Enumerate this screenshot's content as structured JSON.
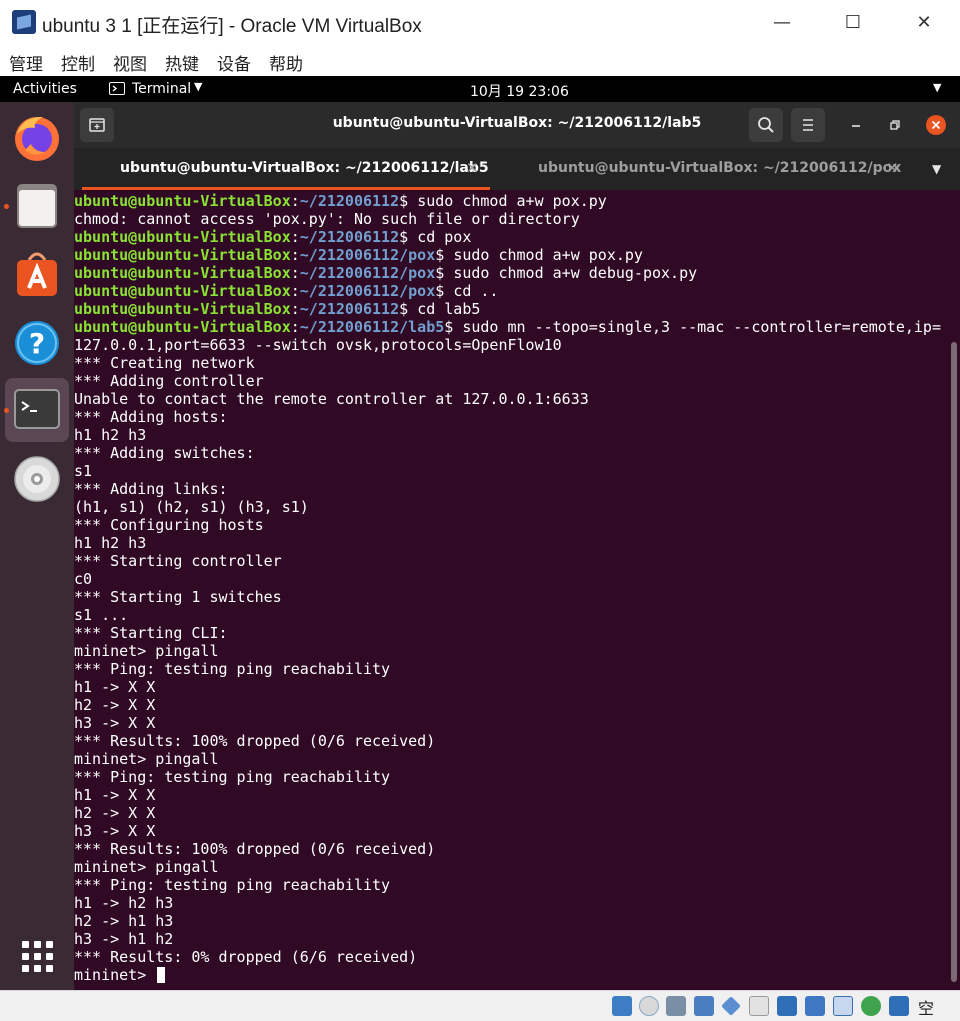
{
  "window": {
    "title": "ubuntu 3 1 [正在运行] - Oracle VM VirtualBox",
    "menu": [
      "管理",
      "控制",
      "视图",
      "热键",
      "设备",
      "帮助"
    ],
    "minimize": "—",
    "maximize": "☐",
    "close": "✕"
  },
  "topbar": {
    "activities": "Activities",
    "app_name": "Terminal",
    "datetime": "10月 19 23:06"
  },
  "terminal": {
    "header_title": "ubuntu@ubuntu-VirtualBox: ~/212006112/lab5",
    "tabs": [
      {
        "label": "ubuntu@ubuntu-VirtualBox: ~/212006112/lab5",
        "active": true
      },
      {
        "label": "ubuntu@ubuntu-VirtualBox: ~/212006112/pox",
        "active": false
      }
    ],
    "user_host": "ubuntu@ubuntu-VirtualBox",
    "lines": [
      {
        "path": "~/212006112",
        "cmd": "sudo chmod a+w pox.py"
      },
      {
        "text": "chmod: cannot access 'pox.py': No such file or directory"
      },
      {
        "path": "~/212006112",
        "cmd": "cd pox"
      },
      {
        "path": "~/212006112/pox",
        "cmd": "sudo chmod a+w pox.py"
      },
      {
        "path": "~/212006112/pox",
        "cmd": "sudo chmod a+w debug-pox.py"
      },
      {
        "path": "~/212006112/pox",
        "cmd": "cd .."
      },
      {
        "path": "~/212006112",
        "cmd": "cd lab5"
      },
      {
        "path": "~/212006112/lab5",
        "cmd": "sudo mn --topo=single,3 --mac --controller=remote,ip="
      },
      {
        "text": "127.0.0.1,port=6633 --switch ovsk,protocols=OpenFlow10"
      },
      {
        "text": "*** Creating network"
      },
      {
        "text": "*** Adding controller"
      },
      {
        "text": "Unable to contact the remote controller at 127.0.0.1:6633"
      },
      {
        "text": "*** Adding hosts:"
      },
      {
        "text": "h1 h2 h3"
      },
      {
        "text": "*** Adding switches:"
      },
      {
        "text": "s1"
      },
      {
        "text": "*** Adding links:"
      },
      {
        "text": "(h1, s1) (h2, s1) (h3, s1)"
      },
      {
        "text": "*** Configuring hosts"
      },
      {
        "text": "h1 h2 h3"
      },
      {
        "text": "*** Starting controller"
      },
      {
        "text": "c0"
      },
      {
        "text": "*** Starting 1 switches"
      },
      {
        "text": "s1 ..."
      },
      {
        "text": "*** Starting CLI:"
      },
      {
        "text": "mininet> pingall"
      },
      {
        "text": "*** Ping: testing ping reachability"
      },
      {
        "text": "h1 -> X X"
      },
      {
        "text": "h2 -> X X"
      },
      {
        "text": "h3 -> X X"
      },
      {
        "text": "*** Results: 100% dropped (0/6 received)"
      },
      {
        "text": "mininet> pingall"
      },
      {
        "text": "*** Ping: testing ping reachability"
      },
      {
        "text": "h1 -> X X"
      },
      {
        "text": "h2 -> X X"
      },
      {
        "text": "h3 -> X X"
      },
      {
        "text": "*** Results: 100% dropped (0/6 received)"
      },
      {
        "text": "mininet> pingall"
      },
      {
        "text": "*** Ping: testing ping reachability"
      },
      {
        "text": "h1 -> h2 h3"
      },
      {
        "text": "h2 -> h1 h3"
      },
      {
        "text": "h3 -> h1 h2"
      },
      {
        "text": "*** Results: 0% dropped (6/6 received)"
      },
      {
        "text": "mininet> ",
        "cursor": true
      }
    ]
  },
  "statusbar": {
    "host_key": "空"
  },
  "colors": {
    "terminal_bg": "#300a24",
    "prompt_user": "#8ae234",
    "prompt_path": "#729fcf",
    "accent": "#e95420"
  }
}
